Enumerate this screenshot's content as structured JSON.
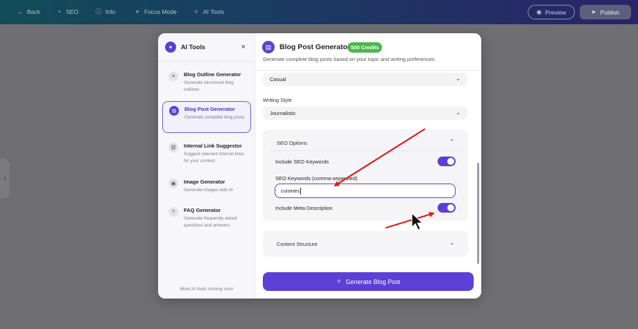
{
  "topbar": {
    "back": "Back",
    "seo": "SEO",
    "info": "Info",
    "focus_mode": "Focus Mode",
    "ai_tools": "AI Tools",
    "preview": "Preview",
    "publish": "Publish"
  },
  "sidebar": {
    "title": "AI Tools",
    "close": "×",
    "items": [
      {
        "name": "Blog Outline Generator",
        "desc": "Generate structured blog outlines",
        "icon": "document-icon",
        "glyph": "≡"
      },
      {
        "name": "Blog Post Generator",
        "desc": "Generate complete blog posts",
        "icon": "article-icon",
        "glyph": "▤"
      },
      {
        "name": "Internal Link Suggestor",
        "desc": "Suggest relevant internal links for your content",
        "icon": "link-icon",
        "glyph": "⛓"
      },
      {
        "name": "Image Generator",
        "desc": "Generate images with AI",
        "icon": "image-icon",
        "glyph": "▣"
      },
      {
        "name": "FAQ Generator",
        "desc": "Generate frequently asked questions and answers",
        "icon": "help-icon",
        "glyph": "?"
      }
    ],
    "footer": "More AI tools coming soon"
  },
  "main": {
    "title": "Blog Post Generator",
    "credits": "500 Credits",
    "subtitle": "Generate complete blog posts based on your topic and writing preferences.",
    "tone_value": "Casual",
    "writing_style_label": "Writing Style",
    "writing_style_value": "Journalistic",
    "seo": {
      "heading": "SEO Options",
      "include_keywords_label": "Include SEO Keywords",
      "include_keywords_on": true,
      "keywords_label": "SEO Keywords (comma-separated)",
      "keywords_value": "cuisines",
      "include_meta_label": "Include Meta Description",
      "include_meta_on": true
    },
    "content_structure": "Content Structure",
    "generate_button": "Generate Blog Post"
  },
  "colors": {
    "accent": "#5b3fd6",
    "credits_badge": "#4cb84c",
    "annotation_arrow": "#e01919"
  }
}
